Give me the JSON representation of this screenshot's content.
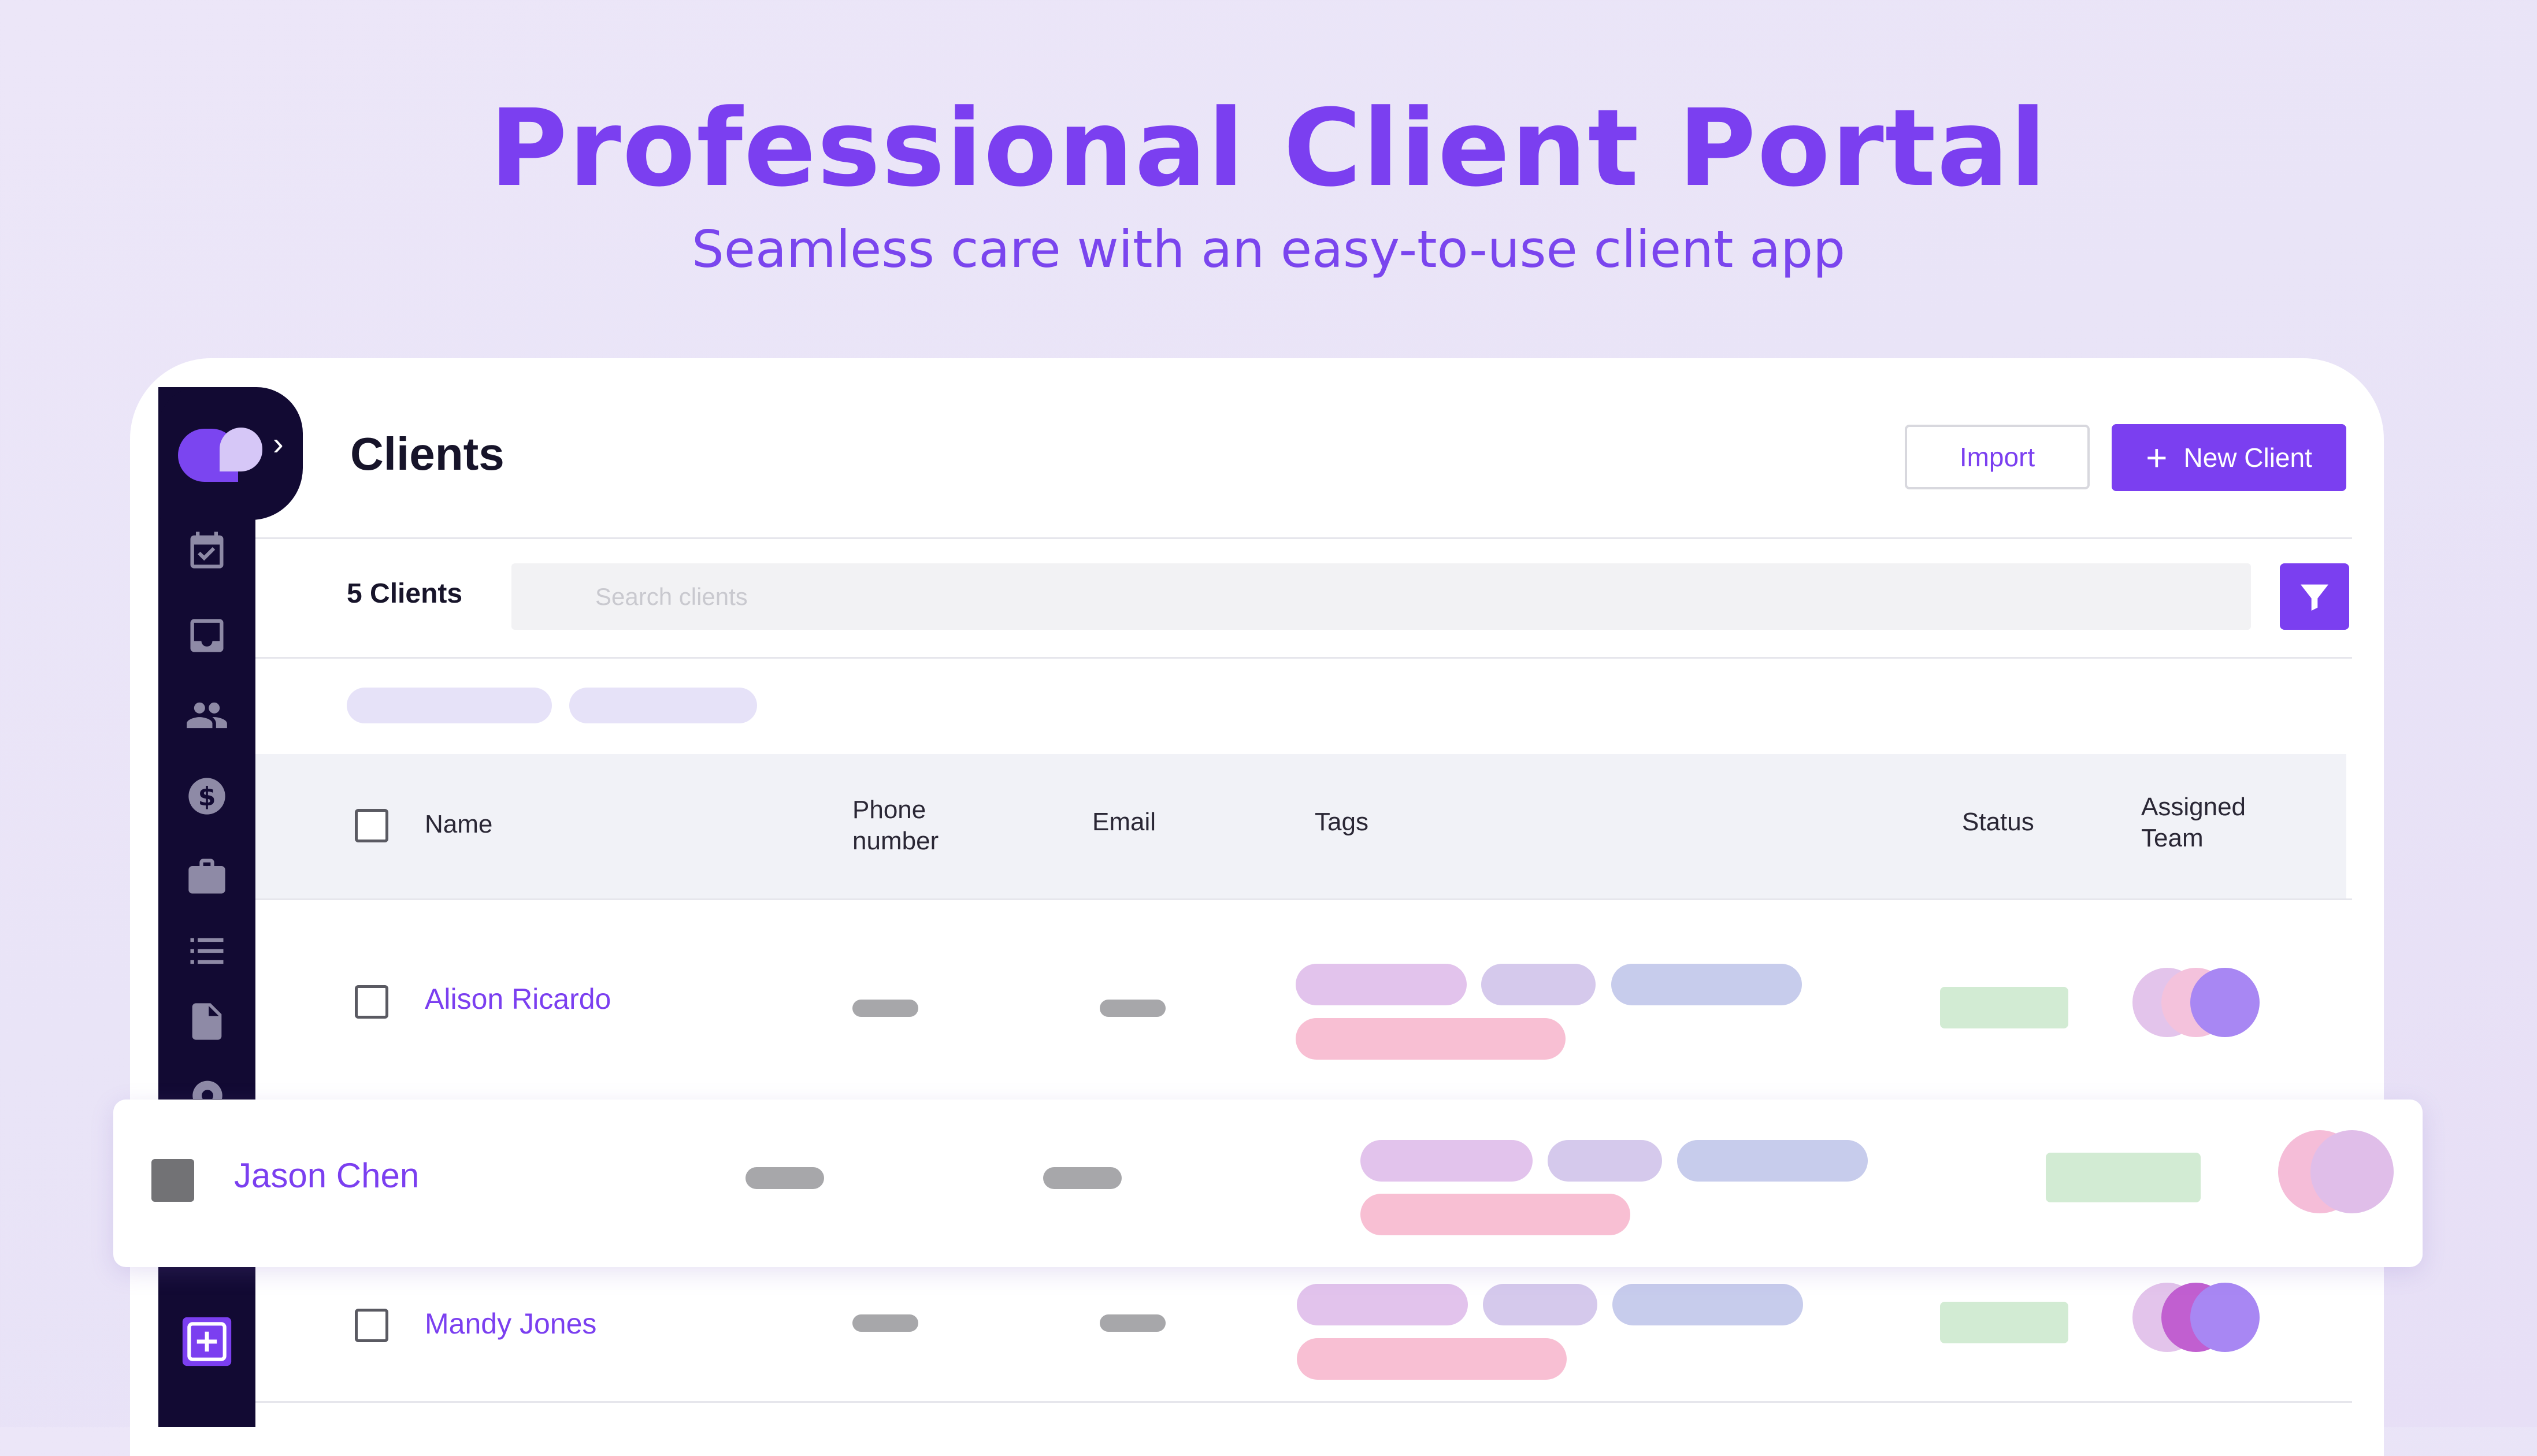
{
  "hero": {
    "title": "Professional Client Portal",
    "subtitle": "Seamless care with an easy-to-use client app"
  },
  "header": {
    "title": "Clients",
    "import_label": "Import",
    "new_client_label": "New Client"
  },
  "toolbar": {
    "count_label": "5 Clients",
    "search_placeholder": "Search clients"
  },
  "table": {
    "columns": {
      "name": "Name",
      "phone_line1": "Phone",
      "phone_line2": "number",
      "email": "Email",
      "tags": "Tags",
      "status": "Status",
      "team_line1": "Assigned",
      "team_line2": "Team"
    },
    "rows": [
      {
        "name": "Alison Ricardo"
      },
      {
        "name": "Jason Chen"
      },
      {
        "name": "Mandy Jones"
      }
    ]
  },
  "sidebar": {
    "icons": [
      "calendar-check-icon",
      "inbox-icon",
      "people-icon",
      "dollar-icon",
      "briefcase-icon",
      "list-icon",
      "document-icon",
      "gear-icon",
      "add-box-icon"
    ]
  },
  "colors": {
    "accent": "#7B3FF0",
    "sidebar": "#120A33",
    "tag_purple": "#E2C3EC",
    "tag_lavender": "#D5C9EC",
    "tag_blue": "#C7CCEC",
    "tag_pink": "#F8BFD3",
    "status_green": "#D2EBD3"
  }
}
